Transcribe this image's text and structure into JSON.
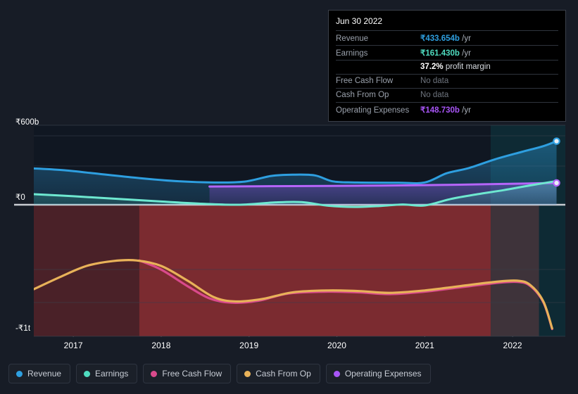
{
  "tooltip": {
    "date": "Jun 30 2022",
    "rows": [
      {
        "key": "Revenue",
        "value": "₹433.654b",
        "unit": "/yr",
        "style": "rev"
      },
      {
        "key": "Earnings",
        "value": "₹161.430b",
        "unit": "/yr",
        "style": "earn"
      },
      {
        "key": "",
        "value": "37.2%",
        "unit": "profit margin",
        "style": "margin"
      },
      {
        "key": "Free Cash Flow",
        "value": "No data",
        "unit": "",
        "style": "nodata"
      },
      {
        "key": "Cash From Op",
        "value": "No data",
        "unit": "",
        "style": "nodata"
      },
      {
        "key": "Operating Expenses",
        "value": "₹148.730b",
        "unit": "/yr",
        "style": "opex"
      }
    ]
  },
  "legend": {
    "items": [
      {
        "label": "Revenue",
        "color": "#2e9fe0"
      },
      {
        "label": "Earnings",
        "color": "#4fdcc0"
      },
      {
        "label": "Free Cash Flow",
        "color": "#d94a8c"
      },
      {
        "label": "Cash From Op",
        "color": "#e8b259"
      },
      {
        "label": "Operating Expenses",
        "color": "#a855f7"
      }
    ]
  },
  "chart_data": {
    "type": "area",
    "title": "",
    "xlabel": "",
    "ylabel": "",
    "grid": true,
    "legend_position": "bottom",
    "ylim": [
      -1000,
      600
    ],
    "y_unit_note": "values in ₹ billions; -₹1t = -1000b",
    "y_ticks": [
      {
        "label": "₹600b",
        "value": 600
      },
      {
        "label": "₹0",
        "value": 0
      },
      {
        "label": "-₹1t",
        "value": -1000
      }
    ],
    "x_ticks": [
      "2017",
      "2018",
      "2019",
      "2020",
      "2021",
      "2022"
    ],
    "xlim": [
      "2016.5",
      "2022.6"
    ],
    "series": [
      {
        "name": "Revenue",
        "color": "#2e9fe0",
        "fill": "#1d4b66",
        "end_marker": true,
        "points": [
          {
            "x": 2016.55,
            "y": 248
          },
          {
            "x": 2016.9,
            "y": 235
          },
          {
            "x": 2017.3,
            "y": 210
          },
          {
            "x": 2017.75,
            "y": 182
          },
          {
            "x": 2018.2,
            "y": 160
          },
          {
            "x": 2018.6,
            "y": 152
          },
          {
            "x": 2018.95,
            "y": 158
          },
          {
            "x": 2019.25,
            "y": 196
          },
          {
            "x": 2019.5,
            "y": 205
          },
          {
            "x": 2019.75,
            "y": 200
          },
          {
            "x": 2019.95,
            "y": 160
          },
          {
            "x": 2020.2,
            "y": 152
          },
          {
            "x": 2020.7,
            "y": 150
          },
          {
            "x": 2021.0,
            "y": 152
          },
          {
            "x": 2021.25,
            "y": 215
          },
          {
            "x": 2021.5,
            "y": 250
          },
          {
            "x": 2021.8,
            "y": 310
          },
          {
            "x": 2022.1,
            "y": 360
          },
          {
            "x": 2022.35,
            "y": 400
          },
          {
            "x": 2022.5,
            "y": 433.654
          }
        ]
      },
      {
        "name": "Earnings",
        "color": "#6ee8d0",
        "fill": "#1f5a5a",
        "end_marker": false,
        "points": [
          {
            "x": 2016.55,
            "y": 72
          },
          {
            "x": 2017.0,
            "y": 58
          },
          {
            "x": 2017.5,
            "y": 40
          },
          {
            "x": 2018.0,
            "y": 22
          },
          {
            "x": 2018.5,
            "y": 6
          },
          {
            "x": 2018.9,
            "y": 0
          },
          {
            "x": 2019.3,
            "y": 16
          },
          {
            "x": 2019.6,
            "y": 18
          },
          {
            "x": 2019.9,
            "y": -8
          },
          {
            "x": 2020.2,
            "y": -18
          },
          {
            "x": 2020.5,
            "y": -10
          },
          {
            "x": 2020.75,
            "y": 2
          },
          {
            "x": 2021.0,
            "y": -6
          },
          {
            "x": 2021.3,
            "y": 40
          },
          {
            "x": 2021.6,
            "y": 72
          },
          {
            "x": 2021.9,
            "y": 100
          },
          {
            "x": 2022.2,
            "y": 132
          },
          {
            "x": 2022.5,
            "y": 161.43
          }
        ]
      },
      {
        "name": "Operating Expenses",
        "color": "#b565f9",
        "fill": "#3a3470",
        "end_marker": true,
        "points": [
          {
            "x": 2018.55,
            "y": 124
          },
          {
            "x": 2019.1,
            "y": 126
          },
          {
            "x": 2019.7,
            "y": 128
          },
          {
            "x": 2020.3,
            "y": 130
          },
          {
            "x": 2020.9,
            "y": 133
          },
          {
            "x": 2021.4,
            "y": 137
          },
          {
            "x": 2021.9,
            "y": 142
          },
          {
            "x": 2022.5,
            "y": 148.73
          }
        ]
      },
      {
        "name": "Cash From Op",
        "color": "#e8b259",
        "fill": "none",
        "end_marker": false,
        "points": [
          {
            "x": 2016.55,
            "y": -690
          },
          {
            "x": 2016.85,
            "y": -590
          },
          {
            "x": 2017.15,
            "y": -500
          },
          {
            "x": 2017.45,
            "y": -460
          },
          {
            "x": 2017.72,
            "y": -455
          },
          {
            "x": 2018.0,
            "y": -500
          },
          {
            "x": 2018.3,
            "y": -620
          },
          {
            "x": 2018.6,
            "y": -755
          },
          {
            "x": 2018.85,
            "y": -790
          },
          {
            "x": 2019.15,
            "y": -770
          },
          {
            "x": 2019.5,
            "y": -715
          },
          {
            "x": 2019.9,
            "y": -700
          },
          {
            "x": 2020.25,
            "y": -705
          },
          {
            "x": 2020.6,
            "y": -720
          },
          {
            "x": 2021.0,
            "y": -700
          },
          {
            "x": 2021.4,
            "y": -665
          },
          {
            "x": 2021.8,
            "y": -630
          },
          {
            "x": 2022.05,
            "y": -620
          },
          {
            "x": 2022.2,
            "y": -655
          },
          {
            "x": 2022.35,
            "y": -790
          },
          {
            "x": 2022.45,
            "y": -1010
          }
        ]
      },
      {
        "name": "Free Cash Flow",
        "color": "#d94a8c",
        "fill": "none",
        "end_marker": false,
        "points": [
          {
            "x": 2017.75,
            "y": -455
          },
          {
            "x": 2018.0,
            "y": -530
          },
          {
            "x": 2018.3,
            "y": -665
          },
          {
            "x": 2018.55,
            "y": -765
          },
          {
            "x": 2018.8,
            "y": -800
          },
          {
            "x": 2019.1,
            "y": -785
          },
          {
            "x": 2019.45,
            "y": -725
          },
          {
            "x": 2019.9,
            "y": -710
          },
          {
            "x": 2020.25,
            "y": -716
          },
          {
            "x": 2020.6,
            "y": -730
          },
          {
            "x": 2021.0,
            "y": -710
          },
          {
            "x": 2021.4,
            "y": -675
          },
          {
            "x": 2021.8,
            "y": -640
          },
          {
            "x": 2022.05,
            "y": -630
          },
          {
            "x": 2022.2,
            "y": -663
          },
          {
            "x": 2022.35,
            "y": -797
          },
          {
            "x": 2022.45,
            "y": -1015
          }
        ]
      }
    ],
    "shaded_regions": [
      {
        "name": "negative-loss-band-early",
        "x_from": 2016.55,
        "x_to": 2017.75,
        "color": "#4a2128"
      },
      {
        "name": "negative-loss-band-main",
        "x_from": 2017.75,
        "x_to": 2022.3,
        "color": "#7b2b30"
      },
      {
        "name": "recent-period-highlight",
        "x_from": 2021.75,
        "x_to": 2022.6,
        "color": "#0d3b44"
      }
    ]
  }
}
